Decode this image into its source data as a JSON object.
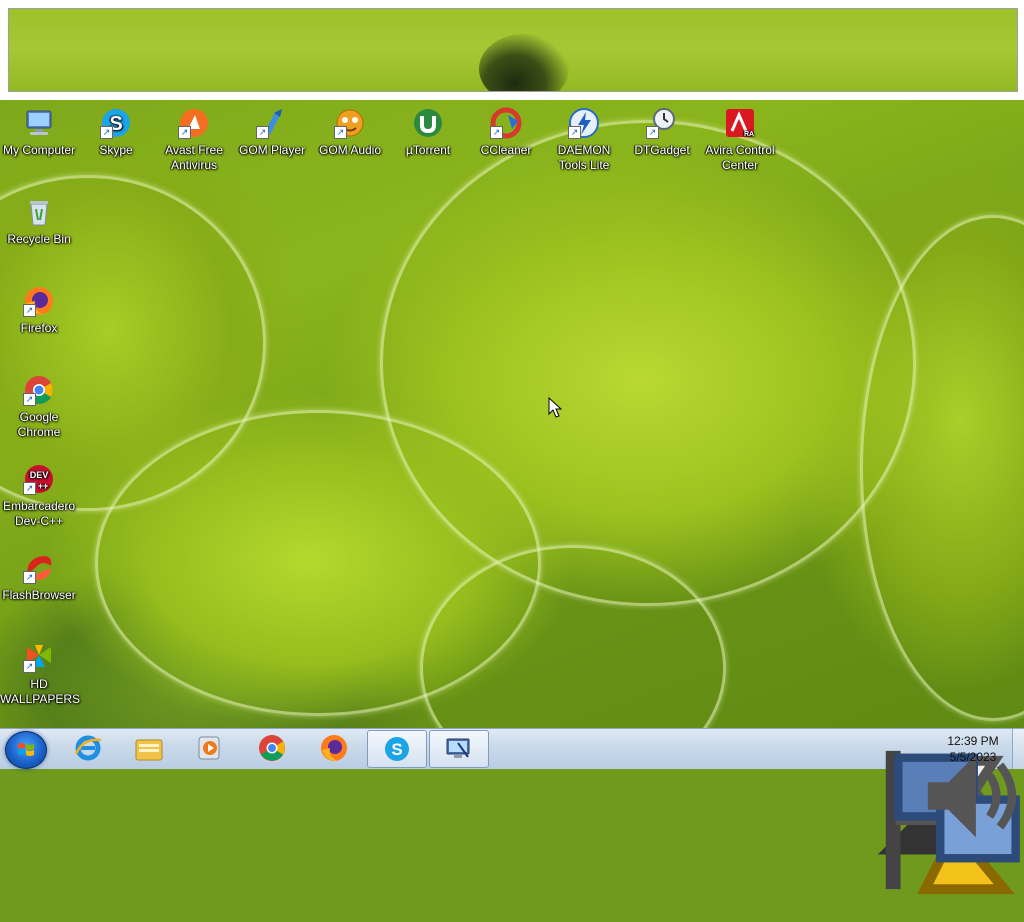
{
  "desktop": {
    "top_row_icons": [
      {
        "label": "My Computer",
        "icon": "computer-icon"
      },
      {
        "label": "Skype",
        "icon": "skype-icon"
      },
      {
        "label": "Avast Free Antivirus",
        "icon": "avast-icon"
      },
      {
        "label": "GOM Player",
        "icon": "gom-player-icon"
      },
      {
        "label": "GOM Audio",
        "icon": "gom-audio-icon"
      },
      {
        "label": "µTorrent",
        "icon": "utorrent-icon"
      },
      {
        "label": "CCleaner",
        "icon": "ccleaner-icon"
      },
      {
        "label": "DAEMON Tools Lite",
        "icon": "daemon-tools-icon"
      },
      {
        "label": "DTGadget",
        "icon": "dtgadget-icon"
      },
      {
        "label": "Avira Control Center",
        "icon": "avira-icon"
      }
    ],
    "left_column_icons": [
      {
        "label": "Recycle Bin",
        "icon": "recycle-bin-icon"
      },
      {
        "label": "Firefox",
        "icon": "firefox-icon"
      },
      {
        "label": "Google Chrome",
        "icon": "chrome-icon"
      },
      {
        "label": "Embarcadero Dev-C++",
        "icon": "devcpp-icon"
      },
      {
        "label": "FlashBrowser",
        "icon": "flashbrowser-icon"
      },
      {
        "label": "HD WALLPAPERS",
        "icon": "hd-wallpapers-icon"
      }
    ]
  },
  "taskbar": {
    "start_icon": "windows-start-icon",
    "pinned": [
      {
        "icon": "internet-explorer-icon",
        "active": false
      },
      {
        "icon": "file-explorer-icon",
        "active": false
      },
      {
        "icon": "media-player-icon",
        "active": false
      },
      {
        "icon": "chrome-icon",
        "active": false
      },
      {
        "icon": "firefox-icon",
        "active": false
      },
      {
        "icon": "skype-icon",
        "active": true
      },
      {
        "icon": "remote-desktop-icon",
        "active": true
      }
    ],
    "tray": {
      "icons": [
        "show-hidden-icons-icon",
        "action-center-flag-icon",
        "network-icon",
        "volume-icon"
      ],
      "time": "12:39 PM",
      "date": "5/5/2023"
    }
  },
  "colors": {
    "wallpaper_green": "#9cc21f",
    "taskbar_blue": "#c9d9ea",
    "start_orb": "#1b62c9"
  }
}
